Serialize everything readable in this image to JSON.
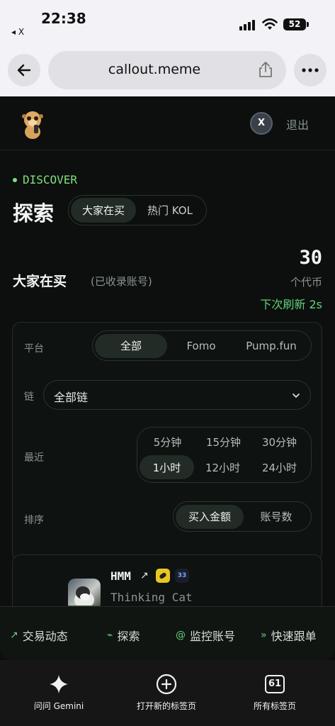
{
  "status": {
    "time": "22:38",
    "back_app": "◂ X",
    "battery": "52"
  },
  "browser": {
    "url": "callout.meme"
  },
  "header": {
    "avatar_letter": "X",
    "logout": "退出"
  },
  "discover_label": "DISCOVER",
  "page_title": "探索",
  "top_tabs": [
    {
      "label": "大家在买",
      "active": true
    },
    {
      "label": "热门 KOL",
      "active": false
    }
  ],
  "section": {
    "title": "大家在买",
    "subtitle": "(已收录账号)"
  },
  "counter": {
    "value": "30",
    "unit": "个代币",
    "refresh": "下次刷新 2s"
  },
  "filters": {
    "platform_label": "平台",
    "platforms": [
      {
        "label": "全部",
        "active": true
      },
      {
        "label": "Fomo",
        "active": false
      },
      {
        "label": "Pump.fun",
        "active": false
      }
    ],
    "chain_label": "链",
    "chain_value": "全部链",
    "recent_label": "最近",
    "recent_row1": [
      {
        "label": "5分钟"
      },
      {
        "label": "15分钟"
      },
      {
        "label": "30分钟"
      }
    ],
    "recent_row2": [
      {
        "label": "1小时",
        "active": true
      },
      {
        "label": "12小时"
      },
      {
        "label": "24小时"
      }
    ],
    "sort_label": "排序",
    "sorts": [
      {
        "label": "买入金额",
        "active": true
      },
      {
        "label": "账号数",
        "active": false
      }
    ]
  },
  "token": {
    "name": "HMM",
    "arrow": "↗",
    "badge2": "33",
    "subtitle": "Thinking Cat"
  },
  "bottom_nav": [
    {
      "icon": "↗",
      "label": "交易动态"
    },
    {
      "icon": "⌁",
      "label": "探索"
    },
    {
      "icon": "@",
      "label": "监控账号"
    },
    {
      "icon": "»",
      "label": "快速跟单"
    }
  ],
  "toolbar": {
    "gemini": "问问 Gemini",
    "new_tab": "打开新的标签页",
    "all_tabs": "所有标签页",
    "tab_count": "61"
  },
  "colors": {
    "accent_green": "#62d27a",
    "background": "#0c0f0d"
  }
}
